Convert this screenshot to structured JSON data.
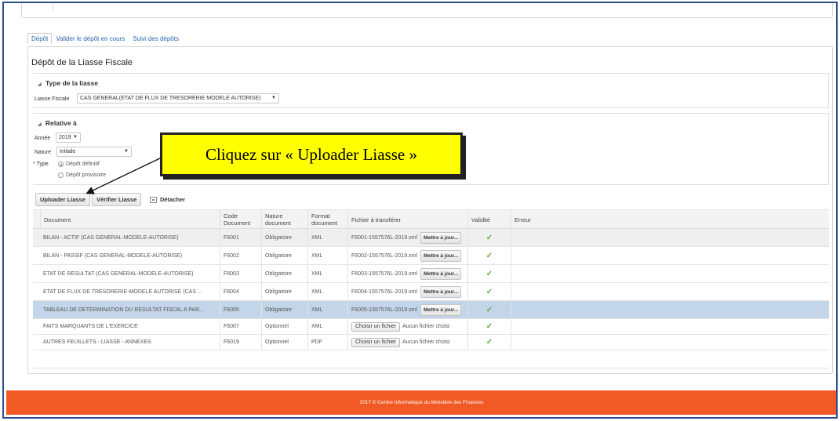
{
  "tabs": [
    {
      "label": "Dépôt",
      "active": true
    },
    {
      "label": "Valider le dépôt en cours",
      "active": false
    },
    {
      "label": "Suivi des dépôts",
      "active": false
    }
  ],
  "page_title": "Dépôt de la Liasse Fiscale",
  "section_type": {
    "title": "Type de la liasse",
    "liasse_label": "Liasse Fiscale",
    "liasse_value": "CAS GENERAL(ETAT DE FLUX DE TRESORERIE MODELE AUTORISE)"
  },
  "section_relative": {
    "title": "Relative à",
    "annee_label": "Année",
    "annee_value": "2019",
    "nature_label": "Nature",
    "nature_value": "Initiale",
    "type_label": "Type",
    "type_required": "*",
    "radio_definitif": "Dépôt définitif",
    "radio_provisoire": "Dépôt provisoire"
  },
  "toolbar": {
    "upload_label": "Uploader Liasse",
    "verify_label": "Vérifier Liasse",
    "detach_label": "Détacher"
  },
  "table": {
    "headers": {
      "document": "Document",
      "code": "Code Document",
      "nature": "Nature document",
      "format": "Format document",
      "fichier": "Fichier à transférer",
      "validite": "Validité",
      "erreur": "Erreur"
    },
    "rows": [
      {
        "document": "BILAN - ACTIF (CAS GENERAL-MODELE-AUTORISE)",
        "code": "F6001",
        "nature": "Obligatoire",
        "format": "XML",
        "fichier": "F6001-1557576L-2019.xml",
        "action": "Mettre à jour...",
        "validite": "✓"
      },
      {
        "document": "BILAN - PASSIF (CAS GENERAL-MODELE-AUTORISE)",
        "code": "F6002",
        "nature": "Obligatoire",
        "format": "XML",
        "fichier": "F6002-1557576L-2019.xml",
        "action": "Mettre à jour...",
        "validite": "✓"
      },
      {
        "document": "ETAT DE RESULTAT (CAS GENERAL-MODELE-AUTORISE)",
        "code": "F6003",
        "nature": "Obligatoire",
        "format": "XML",
        "fichier": "F6003-1557576L-2019.xml",
        "action": "Mettre à jour...",
        "validite": "✓"
      },
      {
        "document": "ETAT DE FLUX DE TRESORERIE-MODELE AUTORISE (CAS ...",
        "code": "F6004",
        "nature": "Obligatoire",
        "format": "XML",
        "fichier": "F6004-1557576L-2019.xml",
        "action": "Mettre à jour...",
        "validite": "✓"
      },
      {
        "document": "TABLEAU DE DETERMINATION DU RESULTAT FISCAL A PAR...",
        "code": "F6005",
        "nature": "Obligatoire",
        "format": "XML",
        "fichier": "F6005-1557576L-2019.xml",
        "action": "Mettre à jour...",
        "validite": "✓"
      },
      {
        "document": "FAITS MARQUANTS DE L'EXERCICE",
        "code": "F6007",
        "nature": "Optionnel",
        "format": "XML",
        "file_button": "Choisir un fichier",
        "no_file": "Aucun fichier choisi",
        "validite": "✓"
      },
      {
        "document": "AUTRES FEUILLETS - LIASSE - ANNEXES",
        "code": "F6019",
        "nature": "Optionnel",
        "format": "PDF",
        "file_button": "Choisir un fichier",
        "no_file": "Aucun fichier choisi",
        "validite": "✓"
      }
    ]
  },
  "footer_text": "2017 © Centre Informatique du Ministère des Finances",
  "callout_text": "Cliquez sur « Uploader Liasse »",
  "colors": {
    "accent": "#f15a24",
    "callout": "#ffff00",
    "selected_row": "#c3d5e8",
    "check": "#5cad3a"
  }
}
